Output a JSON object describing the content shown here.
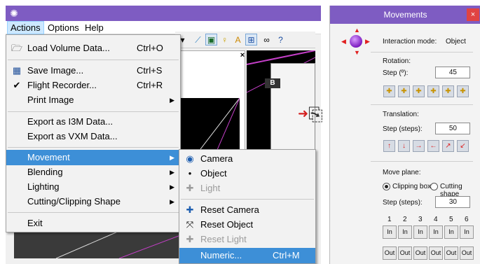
{
  "menubar": {
    "actions": "Actions",
    "options": "Options",
    "help": "Help"
  },
  "actions_menu": {
    "items": [
      {
        "label": "Load Volume Data...",
        "shortcut": "Ctrl+O",
        "icon": "folder-open-icon"
      },
      {
        "label": "Save Image...",
        "shortcut": "Ctrl+S",
        "icon": "save-image-icon"
      },
      {
        "label": "Flight Recorder...",
        "shortcut": "Ctrl+R",
        "icon": "checkmark-icon"
      },
      {
        "label": "Print Image",
        "shortcut": "",
        "submenu": true
      },
      {
        "label": "Export as I3M Data...",
        "shortcut": ""
      },
      {
        "label": "Export as VXM Data...",
        "shortcut": ""
      },
      {
        "label": "Movement",
        "shortcut": "",
        "submenu": true,
        "highlighted": true
      },
      {
        "label": "Blending",
        "shortcut": "",
        "submenu": true
      },
      {
        "label": "Lighting",
        "shortcut": "",
        "submenu": true
      },
      {
        "label": "Cutting/Clipping Shape",
        "shortcut": "",
        "submenu": true
      },
      {
        "label": "Exit",
        "shortcut": ""
      }
    ]
  },
  "movement_menu": {
    "items": [
      {
        "label": "Camera",
        "shortcut": "",
        "icon": "eye-icon"
      },
      {
        "label": "Object",
        "shortcut": "",
        "icon": "bullet-icon"
      },
      {
        "label": "Light",
        "shortcut": "",
        "icon": "light-move-icon",
        "disabled": true
      },
      {
        "label": "Reset Camera",
        "shortcut": "",
        "icon": "reset-camera-icon"
      },
      {
        "label": "Reset Object",
        "shortcut": "",
        "icon": "reset-object-icon"
      },
      {
        "label": "Reset Light",
        "shortcut": "",
        "icon": "reset-light-icon",
        "disabled": true
      },
      {
        "label": "Numeric...",
        "shortcut": "Ctrl+M",
        "highlighted": true
      }
    ]
  },
  "panel": {
    "title": "Movements",
    "close": "×",
    "interaction_label": "Interaction mode:",
    "interaction_value": "Object",
    "rotation_label": "Rotation:",
    "rotation_step_label": "Step (º):",
    "rotation_step_value": "45",
    "translation_label": "Translation:",
    "translation_step_label": "Step (steps):",
    "translation_step_value": "50",
    "move_plane_label": "Move plane:",
    "clipping_box": "Clipping box",
    "cutting_shape": "Cutting shape",
    "plane_step_label": "Step (steps):",
    "plane_step_value": "30",
    "plane_numbers": [
      "1",
      "2",
      "3",
      "4",
      "5",
      "6"
    ],
    "in_label": "In",
    "out_label": "Out"
  },
  "inner_window": {
    "close": "×"
  }
}
